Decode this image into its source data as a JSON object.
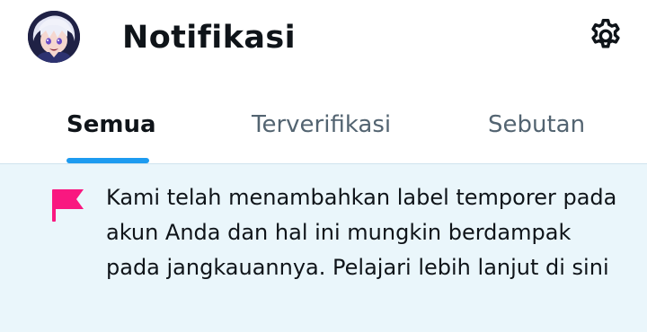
{
  "header": {
    "avatar_icon": "anime-avatar-icon",
    "title": "Notifikasi",
    "settings_icon": "gear-icon"
  },
  "tabs": [
    {
      "label": "Semua",
      "active": true
    },
    {
      "label": "Terverifikasi",
      "active": false
    },
    {
      "label": "Sebutan",
      "active": false
    }
  ],
  "notice": {
    "icon": "flag-icon",
    "message": "Kami telah menambahkan label temporer pada akun Anda dan hal ini mungkin berdampak pada jangkauannya.",
    "link_text": "Pelajari lebih lanjut di sini"
  },
  "colors": {
    "accent": "#1d9bf0",
    "notice_background": "#eaf6fb",
    "flag": "#f91880",
    "text_primary": "#0f1419",
    "text_secondary": "#536471"
  }
}
